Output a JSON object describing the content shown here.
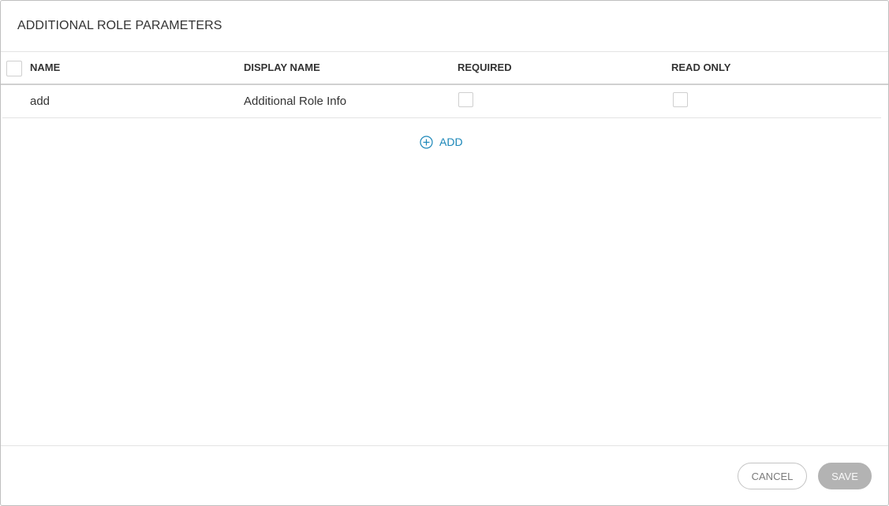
{
  "dialog": {
    "title": "ADDITIONAL ROLE PARAMETERS"
  },
  "table": {
    "columns": [
      "NAME",
      "DISPLAY NAME",
      "REQUIRED",
      "READ ONLY"
    ],
    "rows": [
      {
        "name": "add",
        "display_name": "Additional Role Info",
        "required": false,
        "read_only": false
      }
    ]
  },
  "add_button": {
    "label": "ADD",
    "icon": "plus-circle-icon"
  },
  "footer": {
    "cancel_label": "CANCEL",
    "save_label": "SAVE"
  },
  "colors": {
    "accent": "#1a86b8",
    "save_disabled": "#b3b3b3"
  }
}
